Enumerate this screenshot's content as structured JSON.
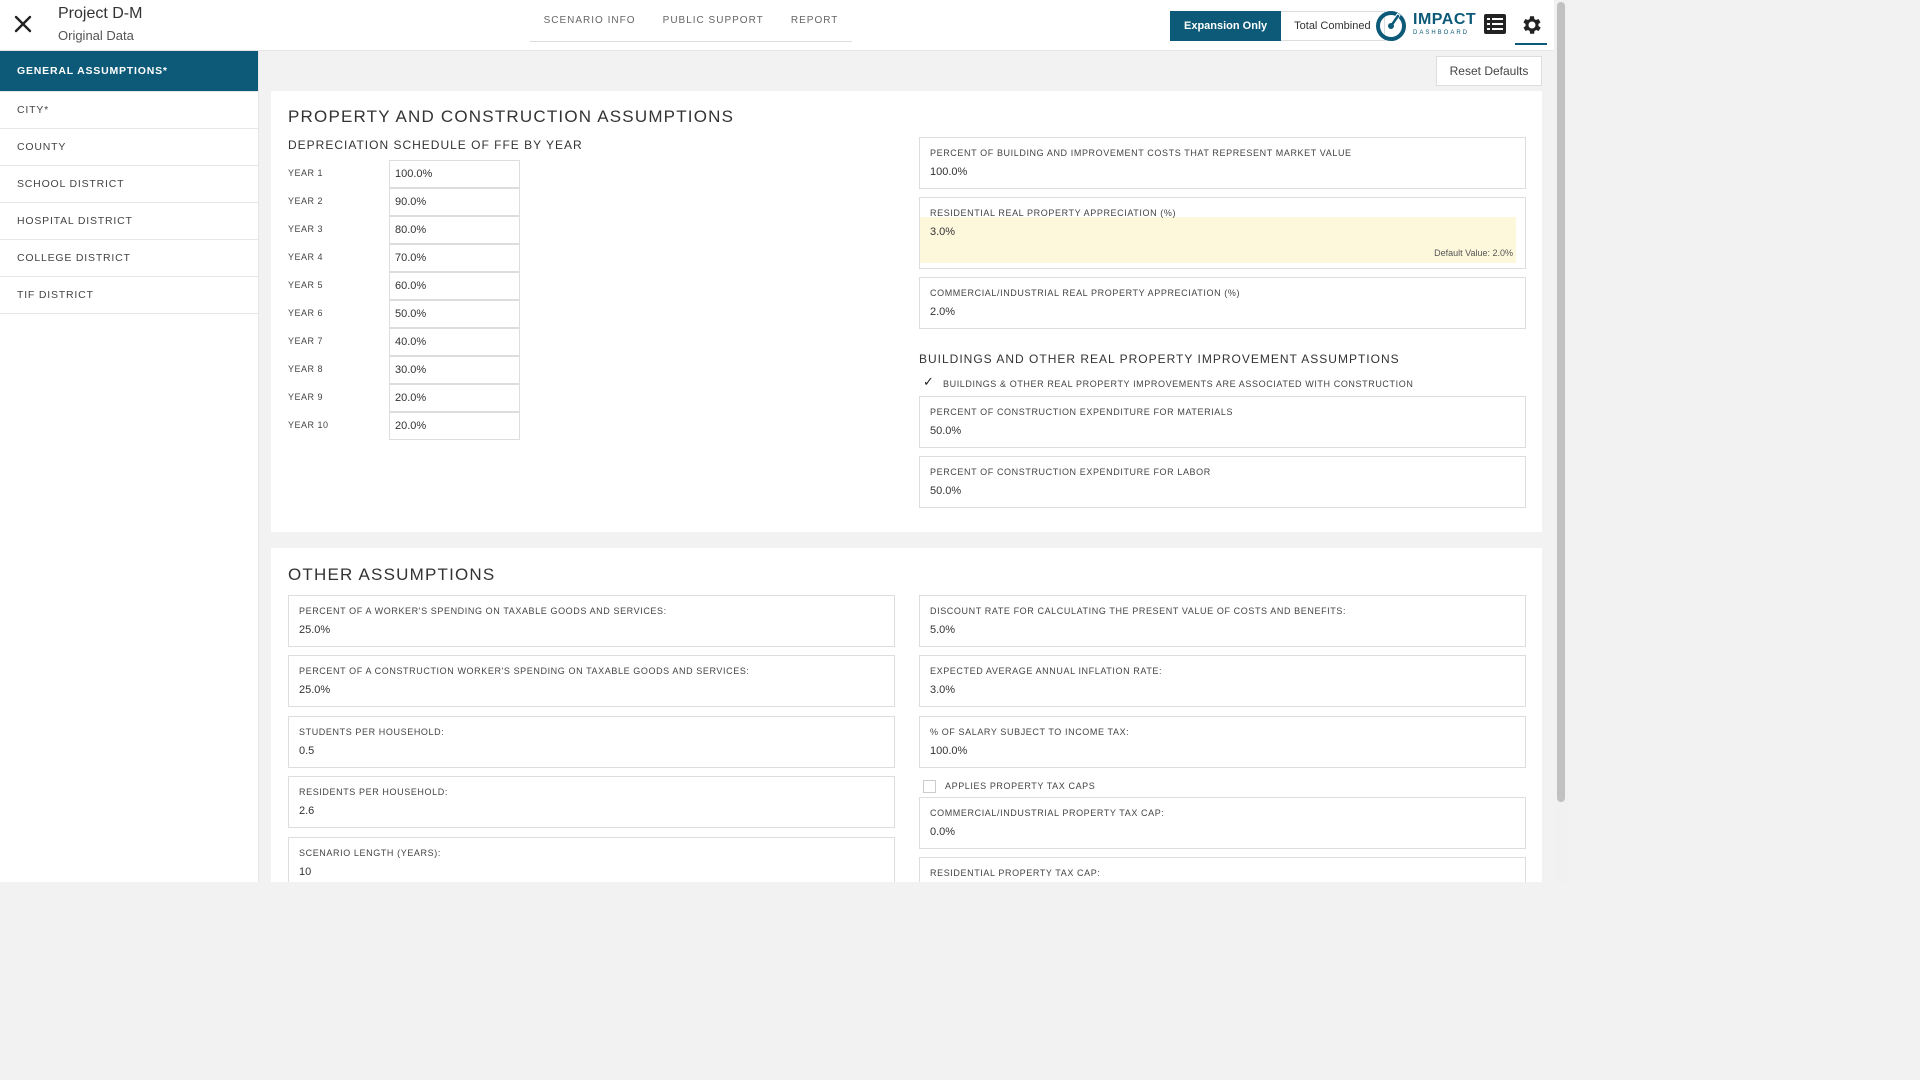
{
  "header": {
    "project_title": "Project D-M",
    "project_subtitle": "Original Data",
    "nav": [
      "SCENARIO INFO",
      "PUBLIC SUPPORT",
      "REPORT"
    ],
    "toggle": {
      "active": "Expansion Only",
      "inactive": "Total Combined"
    },
    "logo": {
      "line1": "IMPACT",
      "line2": "DASHBOARD"
    }
  },
  "sidebar": {
    "items": [
      {
        "label": "GENERAL ASSUMPTIONS*"
      },
      {
        "label": "CITY*"
      },
      {
        "label": "COUNTY"
      },
      {
        "label": "SCHOOL DISTRICT"
      },
      {
        "label": "HOSPITAL DISTRICT"
      },
      {
        "label": "COLLEGE DISTRICT"
      },
      {
        "label": "TIF DISTRICT"
      }
    ]
  },
  "reset_label": "Reset Defaults",
  "property": {
    "title": "PROPERTY AND CONSTRUCTION ASSUMPTIONS",
    "depreciation_title": "DEPRECIATION SCHEDULE OF FFE BY YEAR",
    "years": [
      {
        "label": "YEAR 1",
        "value": "100.0%"
      },
      {
        "label": "YEAR 2",
        "value": "90.0%"
      },
      {
        "label": "YEAR 3",
        "value": "80.0%"
      },
      {
        "label": "YEAR 4",
        "value": "70.0%"
      },
      {
        "label": "YEAR 5",
        "value": "60.0%"
      },
      {
        "label": "YEAR 6",
        "value": "50.0%"
      },
      {
        "label": "YEAR 7",
        "value": "40.0%"
      },
      {
        "label": "YEAR 8",
        "value": "30.0%"
      },
      {
        "label": "YEAR 9",
        "value": "20.0%"
      },
      {
        "label": "YEAR 10",
        "value": "20.0%"
      }
    ],
    "fields": [
      {
        "label": "PERCENT OF BUILDING AND IMPROVEMENT COSTS THAT REPRESENT MARKET VALUE",
        "value": "100.0%"
      },
      {
        "label": "RESIDENTIAL REAL PROPERTY APPRECIATION (%)",
        "value": "3.0%",
        "default_note": "Default Value: 2.0%"
      },
      {
        "label": "COMMERCIAL/INDUSTRIAL REAL PROPERTY APPRECIATION (%)",
        "value": "2.0%"
      }
    ],
    "buildings_title": "BUILDINGS AND OTHER REAL PROPERTY IMPROVEMENT ASSUMPTIONS",
    "buildings_check_label": "BUILDINGS & OTHER REAL PROPERTY IMPROVEMENTS ARE ASSOCIATED WITH CONSTRUCTION",
    "buildings_fields": [
      {
        "label": "PERCENT OF CONSTRUCTION EXPENDITURE FOR MATERIALS",
        "value": "50.0%"
      },
      {
        "label": "PERCENT OF CONSTRUCTION EXPENDITURE FOR LABOR",
        "value": "50.0%"
      }
    ]
  },
  "other": {
    "title": "OTHER ASSUMPTIONS",
    "left_fields": [
      {
        "label": "PERCENT OF A WORKER'S SPENDING ON TAXABLE GOODS AND SERVICES:",
        "value": "25.0%"
      },
      {
        "label": "PERCENT OF A CONSTRUCTION WORKER'S SPENDING ON TAXABLE GOODS AND SERVICES:",
        "value": "25.0%"
      },
      {
        "label": "STUDENTS PER HOUSEHOLD:",
        "value": "0.5"
      },
      {
        "label": "RESIDENTS PER HOUSEHOLD:",
        "value": "2.6"
      },
      {
        "label": "SCENARIO LENGTH (YEARS):",
        "value": "10"
      }
    ],
    "right_fields": [
      {
        "label": "DISCOUNT RATE FOR CALCULATING THE PRESENT VALUE OF COSTS AND BENEFITS:",
        "value": "5.0%"
      },
      {
        "label": "EXPECTED AVERAGE ANNUAL INFLATION RATE:",
        "value": "3.0%"
      },
      {
        "label": "% OF SALARY SUBJECT TO INCOME TAX:",
        "value": "100.0%"
      }
    ],
    "tax_caps_label": "APPLIES PROPERTY TAX CAPS",
    "tax_fields": [
      {
        "label": "COMMERCIAL/INDUSTRIAL PROPERTY TAX CAP:",
        "value": "0.0%"
      },
      {
        "label": "RESIDENTIAL PROPERTY TAX CAP:",
        "value": ""
      }
    ]
  },
  "colors": {
    "accent": "#0d5a78",
    "highlight": "#fdf7dc"
  }
}
